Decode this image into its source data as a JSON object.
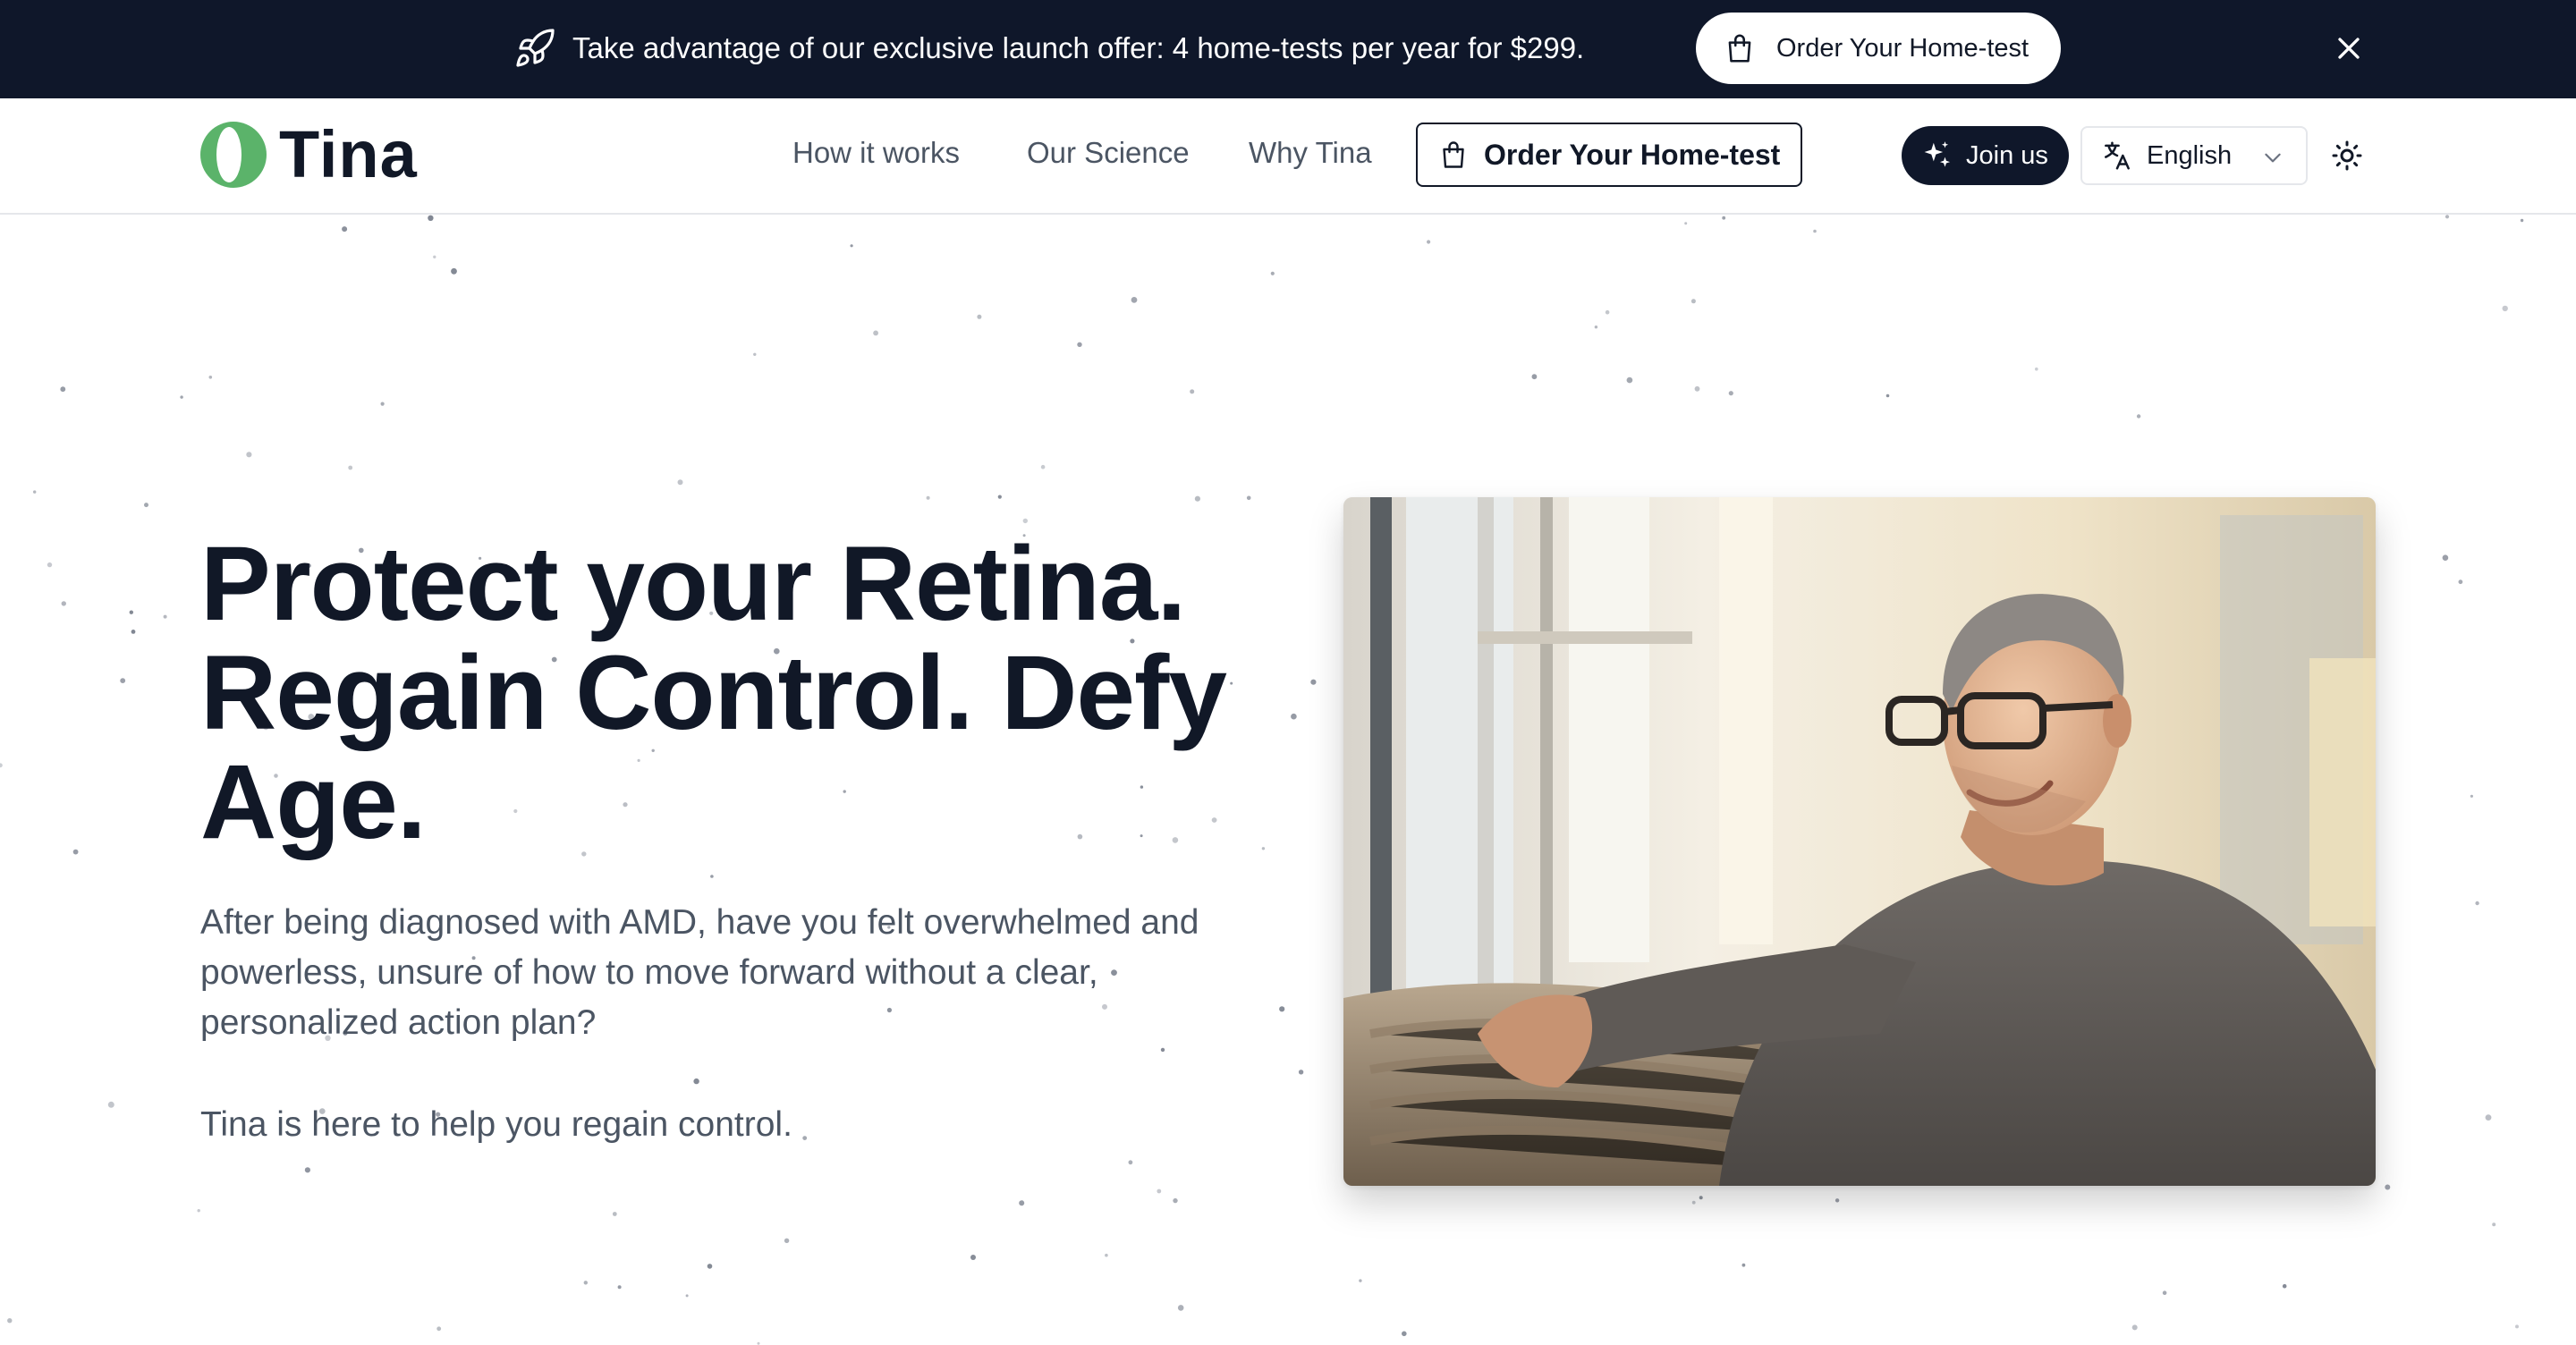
{
  "announcement": {
    "icon": "rocket-icon",
    "message": "Take advantage of our exclusive launch offer: 4 home-tests per year for $299.",
    "cta_label": "Order Your Home-test"
  },
  "header": {
    "logo_text": "Tina",
    "nav": {
      "how_it_works": "How it works",
      "our_science": "Our Science",
      "why_tina": "Why Tina"
    },
    "order_label": "Order Your Home-test",
    "join_label": "Join us",
    "language": "English"
  },
  "hero": {
    "title": "Protect your Retina. Regain Control. Defy Age.",
    "body": "After being diagnosed with AMD, have you felt overwhelmed and powerless, unsure of how to move forward without a clear, personalized action plan?",
    "tagline": "Tina is here to help you regain control."
  },
  "colors": {
    "banner_bg": "#0f172a",
    "brand_green": "#5bb36a",
    "text_dark": "#111827",
    "text_muted": "#4b5563"
  }
}
